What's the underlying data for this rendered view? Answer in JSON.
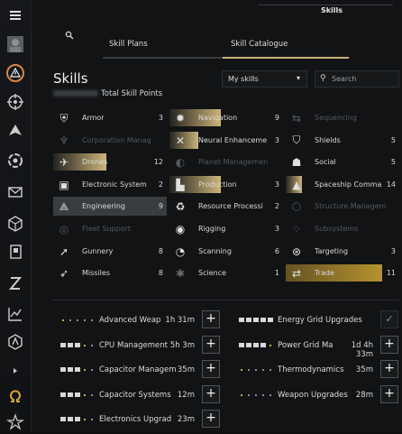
{
  "window": {
    "title": "Skills"
  },
  "tabs": [
    {
      "label": "Skill Plans"
    },
    {
      "label": "Skill Catalogue"
    }
  ],
  "header": {
    "title": "Skills",
    "total_skill_points_label": "Total Skill Points",
    "filter": {
      "selected": "My skills"
    },
    "search": {
      "placeholder": "Search"
    }
  },
  "accent_color": "#cdb47a",
  "categories": [
    {
      "name": "Armor",
      "count": "3",
      "icon": "armor-icon",
      "progress": 0,
      "dim": false
    },
    {
      "name": "Navigation",
      "count": "9",
      "icon": "gear-icon",
      "progress": 0.45,
      "dim": false
    },
    {
      "name": "Sequencing",
      "count": "",
      "icon": "sequencing-icon",
      "progress": 0,
      "dim": true
    },
    {
      "name": "Corporation Manag",
      "count": "",
      "icon": "corporation-icon",
      "progress": 0,
      "dim": true
    },
    {
      "name": "Neural Enhanceme",
      "count": "3",
      "icon": "neural-icon",
      "progress": 0.25,
      "dim": false
    },
    {
      "name": "Shields",
      "count": "5",
      "icon": "shield-icon",
      "progress": 0,
      "dim": false
    },
    {
      "name": "Drones",
      "count": "12",
      "icon": "drone-icon",
      "progress": 0.47,
      "dim": false
    },
    {
      "name": "Planet Managemen",
      "count": "",
      "icon": "planet-icon",
      "progress": 0,
      "dim": true
    },
    {
      "name": "Social",
      "count": "5",
      "icon": "social-icon",
      "progress": 0,
      "dim": false
    },
    {
      "name": "Electronic System",
      "count": "2",
      "icon": "chip-icon",
      "progress": 0,
      "dim": false
    },
    {
      "name": "Production",
      "count": "3",
      "icon": "factory-icon",
      "progress": 0.45,
      "dim": false
    },
    {
      "name": "Spaceship Comma",
      "count": "14",
      "icon": "spaceship-icon",
      "progress": 0.14,
      "dim": false
    },
    {
      "name": "Engineering",
      "count": "9",
      "icon": "engineering-icon",
      "progress": 0,
      "dim": false,
      "selected": true
    },
    {
      "name": "Resource Processi",
      "count": "2",
      "icon": "recycle-icon",
      "progress": 0,
      "dim": false
    },
    {
      "name": "Structure Managem",
      "count": "",
      "icon": "structure-icon",
      "progress": 0,
      "dim": true
    },
    {
      "name": "Fleet Support",
      "count": "",
      "icon": "fleet-icon",
      "progress": 0,
      "dim": true
    },
    {
      "name": "Rigging",
      "count": "3",
      "icon": "rigging-icon",
      "progress": 0,
      "dim": false
    },
    {
      "name": "Subsystems",
      "count": "",
      "icon": "subsystems-icon",
      "progress": 0,
      "dim": true
    },
    {
      "name": "Gunnery",
      "count": "8",
      "icon": "gunnery-icon",
      "progress": 0,
      "dim": false
    },
    {
      "name": "Scanning",
      "count": "6",
      "icon": "scanning-icon",
      "progress": 0,
      "dim": false
    },
    {
      "name": "Targeting",
      "count": "3",
      "icon": "targeting-icon",
      "progress": 0,
      "dim": false
    },
    {
      "name": "Missiles",
      "count": "8",
      "icon": "missile-icon",
      "progress": 0,
      "dim": false
    },
    {
      "name": "Science",
      "count": "1",
      "icon": "science-icon",
      "progress": 0,
      "dim": false
    },
    {
      "name": "Trade",
      "count": "11",
      "icon": "trade-icon",
      "progress": 0.85,
      "dim": false
    }
  ],
  "queue": [
    {
      "name": "Advanced Weap",
      "time": "1h 31m",
      "level": 0,
      "partial": 1,
      "completed": false
    },
    {
      "name": "Energy Grid Upgrades",
      "time": "",
      "level": 5,
      "partial": 0,
      "completed": true
    },
    {
      "name": "CPU Management",
      "time": "5h 3m",
      "level": 3,
      "partial": 1,
      "completed": false
    },
    {
      "name": "Power Grid Ma",
      "time": "1d 4h 33m",
      "level": 4,
      "partial": 1,
      "completed": false
    },
    {
      "name": "Capacitor Managem",
      "time": "35m",
      "level": 3,
      "partial": 1,
      "completed": false
    },
    {
      "name": "Thermodynamics",
      "time": "35m",
      "level": 0,
      "partial": 1,
      "completed": false
    },
    {
      "name": "Capacitor Systems",
      "time": "12m",
      "level": 3,
      "partial": 1,
      "completed": false
    },
    {
      "name": "Weapon Upgrades",
      "time": "28m",
      "level": 0,
      "partial": 1,
      "completed": false
    },
    {
      "name": "Electronics Upgrad",
      "time": "23m",
      "level": 3,
      "partial": 1,
      "completed": false
    }
  ],
  "neocom": [
    "menu-icon",
    "avatar",
    "warning-icon",
    "crosshair-icon",
    "fleet-icon",
    "globe-icon",
    "mail-icon",
    "cube-icon",
    "notebook-icon",
    "z-icon",
    "chart-icon",
    "settings-icon",
    "chevron-right-icon",
    "omega-icon",
    "news-icon"
  ]
}
